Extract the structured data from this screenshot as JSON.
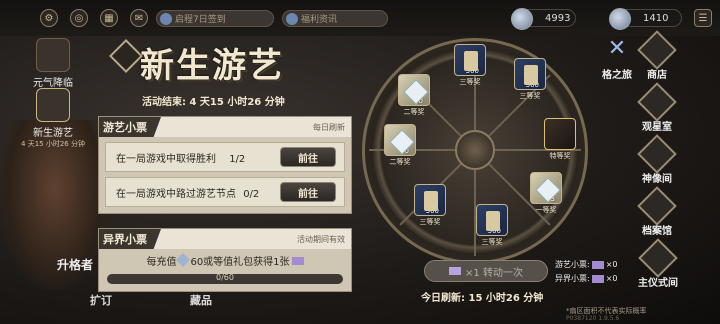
{
  "top": {
    "checkin": "启程7日签到",
    "news": "福利资讯",
    "currency1": "4993",
    "currency2": "1410"
  },
  "left_rail": {
    "item1": "元气降临",
    "item2": "新生游艺",
    "item2_sub": "4 天15 小时26 分钟",
    "item3": "升格者",
    "item4": "扩订"
  },
  "title": "新生游艺",
  "event_end": "活动结束: 4 天15 小时26 分钟",
  "panel1": {
    "title": "游艺小票",
    "note": "每日刷新",
    "tasks": [
      {
        "text": "在一局游戏中取得胜利",
        "progress": "1/2",
        "button": "前往"
      },
      {
        "text": "在一局游戏中路过游艺节点",
        "progress": "0/2",
        "button": "前往"
      }
    ]
  },
  "panel2": {
    "title": "异界小票",
    "note": "活动期间有效",
    "task_text_a": "每充值",
    "task_text_b": "60或等值礼包获得1张",
    "progress_label": "0/60",
    "progress_value": 0
  },
  "wheel": {
    "prizes": [
      {
        "tier": "三等奖",
        "qty": "300"
      },
      {
        "tier": "三等奖",
        "qty": "300"
      },
      {
        "tier": "特等奖",
        "qty": ""
      },
      {
        "tier": "一等奖",
        "qty": "3"
      },
      {
        "tier": "三等奖",
        "qty": "300"
      },
      {
        "tier": "三等奖",
        "qty": "300"
      },
      {
        "tier": "二等奖",
        "qty": "60"
      },
      {
        "tier": "二等奖",
        "qty": "60"
      }
    ]
  },
  "spin_button": "×1 转动一次",
  "refresh": "今日刷新: 15 小时26 分钟",
  "tickets": {
    "youyi_label": "游艺小票:",
    "youyi_count": "×0",
    "yijie_label": "异界小票:",
    "yijie_count": "×0"
  },
  "disclaimer": "*扇区面积不代表实际概率",
  "version": "P0387120 1.9.5.6",
  "right_rail": {
    "item1": "格之旅",
    "item2": "商店",
    "item3": "观星室",
    "item4": "神像间",
    "item5": "档案馆",
    "item6": "主仪式间"
  },
  "bottom": {
    "collection": "藏品"
  }
}
